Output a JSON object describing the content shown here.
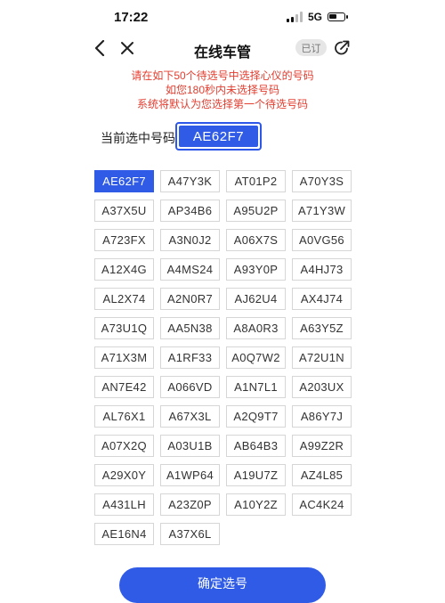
{
  "status_bar": {
    "time": "17:22",
    "network": "5G",
    "battery_level": 0.55
  },
  "nav": {
    "back_icon": "chevron-left-icon",
    "close_icon": "close-icon",
    "title": "在线车管",
    "subscribe_label": "已订",
    "share_icon": "share-icon"
  },
  "notice": {
    "lines": [
      "请在如下50个待选号中选择心仪的号码",
      "如您180秒内未选择号码",
      "系统将默认为您选择第一个待选号码"
    ],
    "color": "#e33d2f"
  },
  "current": {
    "label": "当前选中号码:",
    "value": "AE62F7"
  },
  "plates": [
    "AE62F7",
    "A47Y3K",
    "AT01P2",
    "A70Y3S",
    "A37X5U",
    "AP34B6",
    "A95U2P",
    "A71Y3W",
    "A723FX",
    "A3N0J2",
    "A06X7S",
    "A0VG56",
    "A12X4G",
    "A4MS24",
    "A93Y0P",
    "A4HJ73",
    "AL2X74",
    "A2N0R7",
    "AJ62U4",
    "AX4J74",
    "A73U1Q",
    "AA5N38",
    "A8A0R3",
    "A63Y5Z",
    "A71X3M",
    "A1RF33",
    "A0Q7W2",
    "A72U1N",
    "AN7E42",
    "A066VD",
    "A1N7L1",
    "A203UX",
    "AL76X1",
    "A67X3L",
    "A2Q9T7",
    "A86Y7J",
    "A07X2Q",
    "A03U1B",
    "AB64B3",
    "A99Z2R",
    "A29X0Y",
    "A1WP64",
    "A19U7Z",
    "AZ4L85",
    "A431LH",
    "A23Z0P",
    "A10Y2Z",
    "AC4K24",
    "AE16N4",
    "A37X6L"
  ],
  "selected_index": 0,
  "confirm_label": "确定选号",
  "accent_color": "#2f5be6"
}
